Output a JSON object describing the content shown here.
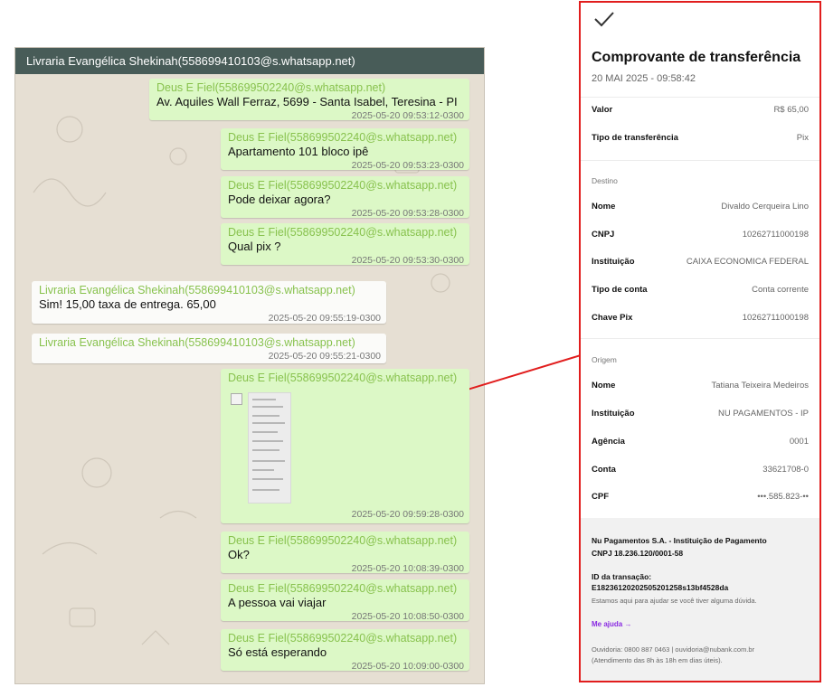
{
  "chat": {
    "title": "Livraria Evangélica Shekinah(558699410103@s.whatsapp.net)",
    "messages": [
      {
        "dir": "out",
        "author": "Deus E Fiel(558699502240@s.whatsapp.net)",
        "text": "Av. Aquiles Wall Ferraz, 5699 - Santa Isabel, Teresina - PI",
        "time": "2025-05-20 09:53:12-0300"
      },
      {
        "dir": "out",
        "author": "Deus E Fiel(558699502240@s.whatsapp.net)",
        "text": "Apartamento 101 bloco ipê",
        "time": "2025-05-20 09:53:23-0300"
      },
      {
        "dir": "out",
        "author": "Deus E Fiel(558699502240@s.whatsapp.net)",
        "text": "Pode deixar agora?",
        "time": "2025-05-20 09:53:28-0300"
      },
      {
        "dir": "out",
        "author": "Deus E Fiel(558699502240@s.whatsapp.net)",
        "text": "Qual pix ?",
        "time": "2025-05-20 09:53:30-0300"
      },
      {
        "dir": "in",
        "author": "Livraria Evangélica Shekinah(558699410103@s.whatsapp.net)",
        "text": "Sim! 15,00 taxa de entrega. 65,00",
        "time": "2025-05-20 09:55:19-0300"
      },
      {
        "dir": "in",
        "author": "Livraria Evangélica Shekinah(558699410103@s.whatsapp.net)",
        "text": "",
        "time": "2025-05-20 09:55:21-0300"
      },
      {
        "dir": "out",
        "author": "Deus E Fiel(558699502240@s.whatsapp.net)",
        "text": "",
        "time": "2025-05-20 09:59:28-0300"
      },
      {
        "dir": "out",
        "author": "Deus E Fiel(558699502240@s.whatsapp.net)",
        "text": "Ok?",
        "time": "2025-05-20 10:08:39-0300"
      },
      {
        "dir": "out",
        "author": "Deus E Fiel(558699502240@s.whatsapp.net)",
        "text": "A pessoa vai viajar",
        "time": "2025-05-20 10:08:50-0300"
      },
      {
        "dir": "out",
        "author": "Deus E Fiel(558699502240@s.whatsapp.net)",
        "text": "Só está esperando",
        "time": "2025-05-20 10:09:00-0300"
      }
    ]
  },
  "receipt": {
    "title": "Comprovante de transferência",
    "date": "20 MAI 2025 - 09:58:42",
    "valor_label": "Valor",
    "valor_value": "R$ 65,00",
    "tipo_label": "Tipo de transferência",
    "tipo_value": "Pix",
    "destino_header": "Destino",
    "destino": [
      {
        "label": "Nome",
        "value": "Divaldo Cerqueira Lino"
      },
      {
        "label": "CNPJ",
        "value": "10262711000198"
      },
      {
        "label": "Instituição",
        "value": "CAIXA ECONOMICA FEDERAL"
      },
      {
        "label": "Tipo de conta",
        "value": "Conta corrente"
      },
      {
        "label": "Chave Pix",
        "value": "10262711000198"
      }
    ],
    "origem_header": "Origem",
    "origem": [
      {
        "label": "Nome",
        "value": "Tatiana Teixeira Medeiros"
      },
      {
        "label": "Instituição",
        "value": "NU PAGAMENTOS - IP"
      },
      {
        "label": "Agência",
        "value": "0001"
      },
      {
        "label": "Conta",
        "value": "33621708-0"
      },
      {
        "label": "CPF",
        "value": "•••.585.823-••"
      }
    ],
    "footer": {
      "company": "Nu Pagamentos S.A. - Instituição de Pagamento",
      "cnpj": "CNPJ 18.236.120/0001-58",
      "id_label": "ID da transação:",
      "id_value": "E18236120202505201258s13bf4528da",
      "help_text": "Estamos aqui para ajudar se você tiver alguma dúvida.",
      "help_link": "Me ajuda  →",
      "ouvidoria": "Ouvidoria: 0800 887 0463 | ouvidoria@nubank.com.br",
      "hours": "(Atendimento das 8h às 18h em dias úteis)."
    },
    "accent_color": "#8a2be2",
    "border_color": "#e11d1d"
  }
}
